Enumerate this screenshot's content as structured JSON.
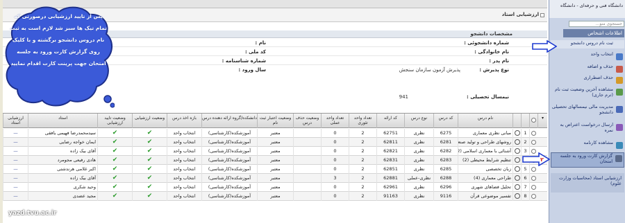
{
  "app": {
    "page_title": "ارزشیابی استاد",
    "section_title": "مشخصات دانشجو"
  },
  "callout": {
    "text": "پس از تایید ارزشیابی درصورتی که تمام تیک ها سبز شد لازم است به ثبت نام دروس دانشجو برگشته و با کلیک روی گزارش کارت ورود به جلسه امتحان جهت پرینت کارت اقدام نمایید"
  },
  "student_info": {
    "student_number_label": "شماره دانشجوئی :",
    "last_name_label": "نام خانوادگی :",
    "father_name_label": "نام پدر :",
    "admission_type_label": "نوع پذیرش :",
    "admission_type_value": "پذیرش آزمون سازمان سنجش",
    "first_name_label": "نام :",
    "national_code_label": "کد ملی :",
    "id_number_label": "شماره شناسنامه :",
    "entry_year_label": "سال ورود :",
    "term_label": "نیمسال تحصیلی :",
    "term_value": "941"
  },
  "table": {
    "headers": {
      "check": "",
      "row": "",
      "course_name": "نام درس",
      "course_code": "کد درس",
      "course_type": "نوع درس",
      "group_code": "کد ارائه",
      "theory_units": "تعداد واحد تئوری",
      "practical_units": "تعداد واحد عملی",
      "drop_status": "وضعیت حذف درس",
      "validity_status": "وضعیت اعتبار ثبت نام",
      "faculty": "دانشکده/گروه ارائه دهنده درس",
      "add_period": "بازه اخذ درس",
      "eval_status": "وضعیت ارزشیابی",
      "confirm_status": "وضعیت تایید ارزشیابی",
      "teacher": "استاد",
      "evaluation": "ارزشیابی استاد"
    },
    "rows": [
      {
        "n": "1",
        "name": "مبانی نظری معماری",
        "code": "6275",
        "type": "نظری",
        "group": "62751",
        "theory": "2",
        "practical": "0",
        "drop": "",
        "valid": "معتبر",
        "faculty": "آموزشکده(کارشناسی)",
        "period": "انتخاب واحد",
        "teacher": "سیدمحمدرضا فهیمی یافقی"
      },
      {
        "n": "2",
        "name": "روشهای طراحی و تولید صنعتی",
        "code": "6281",
        "type": "نظری",
        "group": "62811",
        "theory": "2",
        "practical": "0",
        "drop": "",
        "valid": "معتبر",
        "faculty": "آموزشکده(کارشناسی)",
        "period": "انتخاب واحد",
        "teacher": "ایمان خواجه رضایی"
      },
      {
        "n": "3",
        "name": "آشنائی با معماری اسلامی (2)",
        "code": "6282",
        "type": "نظری",
        "group": "62821",
        "theory": "2",
        "practical": "0",
        "drop": "",
        "valid": "معتبر",
        "faculty": "آموزشکده(کارشناسی)",
        "period": "انتخاب واحد",
        "teacher": "آقای بیک زاده"
      },
      {
        "n": "4",
        "name": "تنظیم شرایط محیطی (2)",
        "code": "6283",
        "type": "نظری",
        "group": "62831",
        "theory": "2",
        "practical": "0",
        "drop": "",
        "valid": "معتبر",
        "faculty": "آموزشکده(کارشناسی)",
        "period": "انتخاب واحد",
        "teacher": "هادی رفیعی مجومرد"
      },
      {
        "n": "5",
        "name": "زبان تخصصی",
        "code": "6285",
        "type": "نظری",
        "group": "62851",
        "theory": "2",
        "practical": "0",
        "drop": "",
        "valid": "معتبر",
        "faculty": "آموزشکده(کارشناسی)",
        "period": "انتخاب واحد",
        "teacher": "اکبر غلامی هرندشتی"
      },
      {
        "n": "6",
        "name": "طراحی معماری (4)",
        "code": "6288",
        "type": "نظری-عملی",
        "group": "62881",
        "theory": "2",
        "practical": "3",
        "drop": "",
        "valid": "معتبر",
        "faculty": "آموزشکده(کارشناسی)",
        "period": "انتخاب واحد",
        "teacher": "آقای بیک زاده"
      },
      {
        "n": "7",
        "name": "تحلیل فضاهای شهری",
        "code": "6296",
        "type": "نظری",
        "group": "62961",
        "theory": "2",
        "practical": "0",
        "drop": "",
        "valid": "معتبر",
        "faculty": "آموزشکده(کارشناسی)",
        "period": "انتخاب واحد",
        "teacher": "وحید شکری"
      },
      {
        "n": "8",
        "name": "تفسیر موضوعی قرآن",
        "code": "9116",
        "type": "نظری",
        "group": "91163",
        "theory": "2",
        "practical": "0",
        "drop": "",
        "valid": "معتبر",
        "faculty": "آموزشکده(کارشناسی)",
        "period": "انتخاب واحد",
        "teacher": "مجید عضدی"
      }
    ]
  },
  "sidebar": {
    "university": "دانشگاه فنی و حرفه‌ای - دانشگاه",
    "search_placeholder": "جستجوی منو...",
    "head": "اطلاعات اشخاص",
    "items": [
      {
        "label": "ثبت نام دروس دانشجو"
      },
      {
        "label": "انتخاب واحد"
      },
      {
        "label": "حذف و اضافه"
      },
      {
        "label": "حذف اضطراری"
      },
      {
        "label": "مشاهده آخرین وضعیت ثبت نام (ترم جاری)"
      },
      {
        "label": "مدیریت مالی نیمسالهای تحصیلی دانشجو"
      },
      {
        "label": "ارسال درخواست اعتراض به نمره"
      },
      {
        "label": "مشاهده کارنامه"
      },
      {
        "label": "گزارش کارت ورود به جلسه امتحان"
      }
    ],
    "footer": "ارزشیابی استاد (محاسبات وزارت علوم)"
  },
  "watermark": "yazd.tvu.ac.ir"
}
